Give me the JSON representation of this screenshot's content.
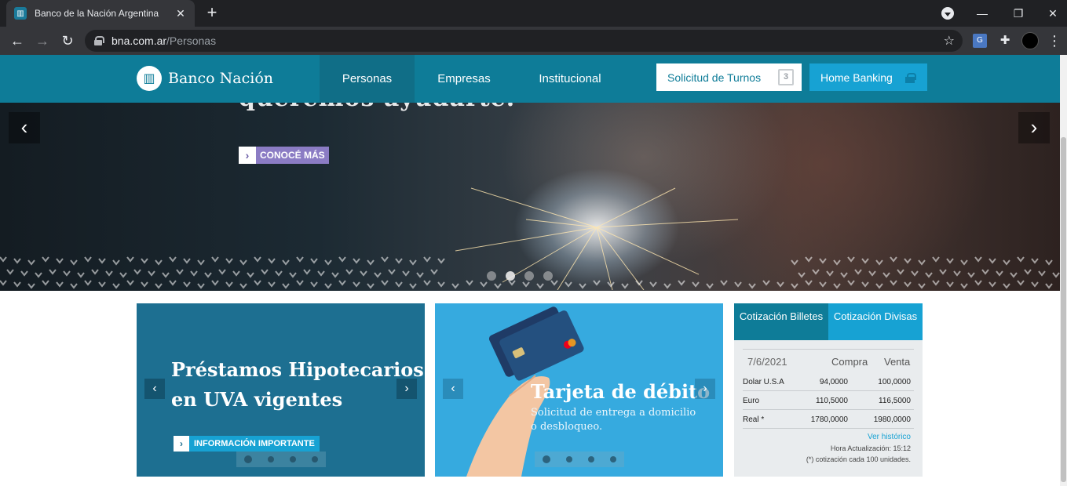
{
  "browser": {
    "tab_title": "Banco de la Nación Argentina",
    "url_host": "bna.com.ar",
    "url_path": "/Personas"
  },
  "header": {
    "logo_text": "Banco Nación",
    "nav": [
      "Personas",
      "Empresas",
      "Institucional"
    ],
    "active_nav": "Personas",
    "turnos_label": "Solicitud de Turnos",
    "turnos_icon_text": "3",
    "homebanking_label": "Home Banking"
  },
  "hero": {
    "headline": "queremos ayudarte.",
    "cta_label": "CONOCÉ MÁS",
    "slide_count": 4,
    "active_slide": 2
  },
  "cards": [
    {
      "title_line1": "Préstamos Hipotecarios",
      "title_line2": "en UVA vigentes",
      "cta_label": "INFORMACIÓN IMPORTANTE",
      "slide_count": 4,
      "active_slide": 1
    },
    {
      "title": "Tarjeta de débito",
      "subtitle_line1": "Solicitud de entrega a domicilio",
      "subtitle_line2": "o desbloqueo.",
      "slide_count": 4,
      "active_slide": 1
    }
  ],
  "cotizacion": {
    "tab1": "Cotización Billetes",
    "tab2": "Cotización Divisas",
    "date": "7/6/2021",
    "col_buy": "Compra",
    "col_sell": "Venta",
    "rows": [
      {
        "name": "Dolar U.S.A",
        "buy": "94,0000",
        "sell": "100,0000"
      },
      {
        "name": "Euro",
        "buy": "110,5000",
        "sell": "116,5000"
      },
      {
        "name": "Real *",
        "buy": "1780,0000",
        "sell": "1980,0000"
      }
    ],
    "history_link": "Ver histórico",
    "update_text": "Hora Actualización: 15:12",
    "note": "(*) cotización cada 100 unidades."
  },
  "colors": {
    "brand_teal": "#0e7c98",
    "brand_cyan": "#17a2d3",
    "card_dark": "#1d6f91",
    "card_light": "#36aadf"
  }
}
